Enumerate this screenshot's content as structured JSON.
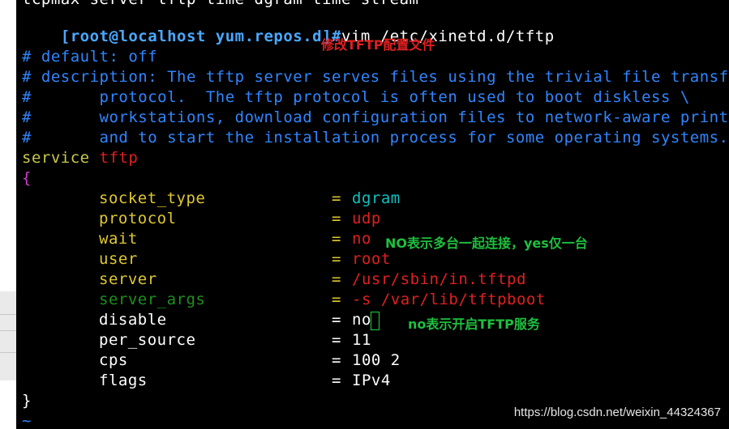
{
  "terminal": {
    "top_cut": "tcpmax server tftp time dgram time stream",
    "prompt": "[root@localhost yum.repos.d]#",
    "command": "vim /etc/xinetd.d/tftp",
    "comments": [
      "# default: off",
      "# description: The tftp server serves files using the trivial file transf",
      "#       protocol.  The tftp protocol is often used to boot diskless \\",
      "#       workstations, download configuration files to network-aware print",
      "#       and to start the installation process for some operating systems."
    ],
    "service_kw": "service",
    "service_name": "tftp",
    "open_brace": "{",
    "close_brace": "}",
    "tilde": "~",
    "settings": [
      {
        "key": "socket_type",
        "value": "dgram"
      },
      {
        "key": "protocol",
        "value": "udp"
      },
      {
        "key": "wait",
        "value": "no"
      },
      {
        "key": "user",
        "value": "root"
      },
      {
        "key": "server",
        "value": "/usr/sbin/in.tftpd"
      },
      {
        "key": "server_args",
        "value": "-s /var/lib/tftpboot"
      },
      {
        "key": "disable",
        "value": "no"
      },
      {
        "key": "per_source",
        "value": "11"
      },
      {
        "key": "cps",
        "value": "100 2"
      },
      {
        "key": "flags",
        "value": "IPv4"
      }
    ],
    "equals": "="
  },
  "annotations": {
    "title": "修改TFTP配置文件",
    "wait_note": "NO表示多台一起连接，yes仅一台",
    "disable_note": "no表示开启TFTP服务"
  },
  "watermark": "https://blog.csdn.net/weixin_44324367",
  "colors": {
    "background": "#000000",
    "prompt": "#4aa8ff",
    "comment": "#2f86ff",
    "keyword": "#c8c84a",
    "red": "#e02020",
    "annotation_green": "#1fbf3f"
  }
}
